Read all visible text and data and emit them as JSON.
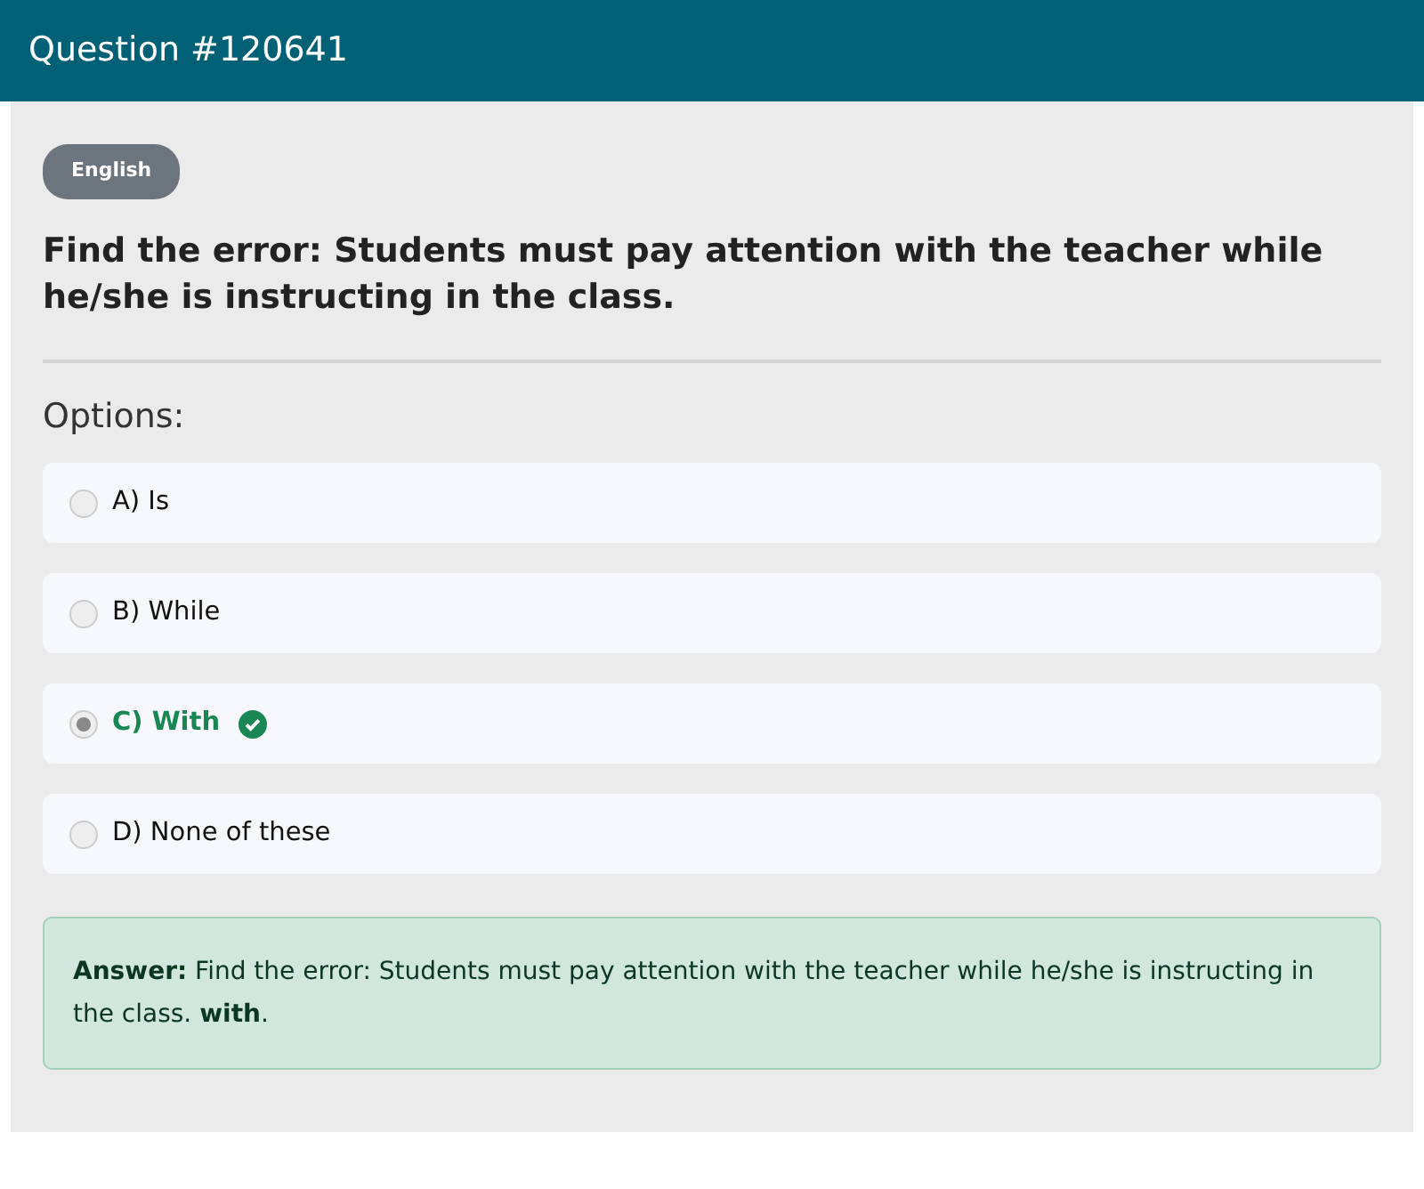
{
  "header": {
    "title": "Question #120641"
  },
  "badge": "English",
  "question": "Find the error: Students must pay attention with the teacher while he/she is instructing in the class.",
  "options_label": "Options:",
  "options": [
    {
      "label": "A) Is",
      "selected": false,
      "correct": false
    },
    {
      "label": "B) While",
      "selected": false,
      "correct": false
    },
    {
      "label": "C) With",
      "selected": true,
      "correct": true
    },
    {
      "label": "D) None of these",
      "selected": false,
      "correct": false
    }
  ],
  "answer": "**Answer:** Find the error: Students must pay attention with the teacher while he/she is instructing in the class. **with**."
}
